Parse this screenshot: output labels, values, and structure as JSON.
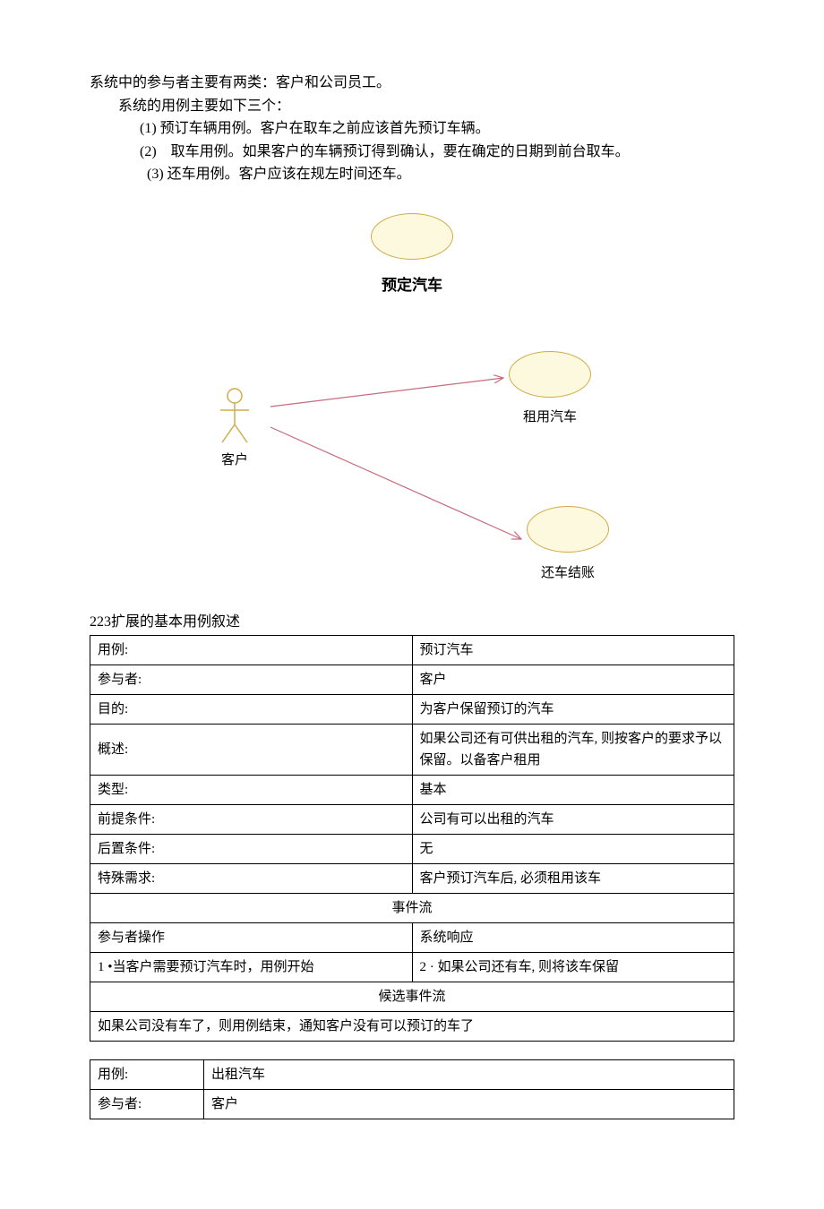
{
  "intro": {
    "line1": "系统中的参与者主要有两类：客户和公司员工。",
    "line2": "系统的用例主要如下三个：",
    "item1": "(1) 预订车辆用例。客户在取车之前应该首先预订车辆。",
    "item2": "(2)　取车用例。如果客户的车辆预订得到确认，要在确定的日期到前台取车。",
    "item3": "(3)  还车用例。客户应该在规左时间还车。"
  },
  "diagram": {
    "top_label": "预定汽车",
    "actor": "客户",
    "uc1": "租用汽车",
    "uc2": "还车结账"
  },
  "section_title": "223扩展的基本用例叙述",
  "table1": {
    "rows": {
      "usecase_label": "用例:",
      "usecase": "预订汽车",
      "actor_label": "参与者:",
      "actor": "客户",
      "goal_label": "目的:",
      "goal": "为客户保留预订的汽车",
      "summary_label": "概述:",
      "summary": "如果公司还有可供出租的汽车, 则按客户的要求予以保留。以备客户租用",
      "type_label": "类型:",
      "type": "基本",
      "pre_label": "前提条件:",
      "pre": "公司有可以出租的汽车",
      "post_label": "后置条件:",
      "post": "无",
      "special_label": "特殊需求:",
      "special": "客户预订汽车后, 必须租用该车"
    },
    "flow_header": "事件流",
    "actor_op_header": "参与者操作",
    "sys_resp_header": "系统响应",
    "actor_op": "1 •当客户需要预订汽车时，用例开始",
    "sys_resp": "2 · 如果公司还有车, 则将该车保留",
    "alt_header": "候选事件流",
    "alt_text": "如果公司没有车了，则用例结束，通知客户没有可以预订的车了"
  },
  "table2": {
    "usecase_label": "用例:",
    "usecase": "出租汽车",
    "actor_label": "参与者:",
    "actor": "客户"
  }
}
